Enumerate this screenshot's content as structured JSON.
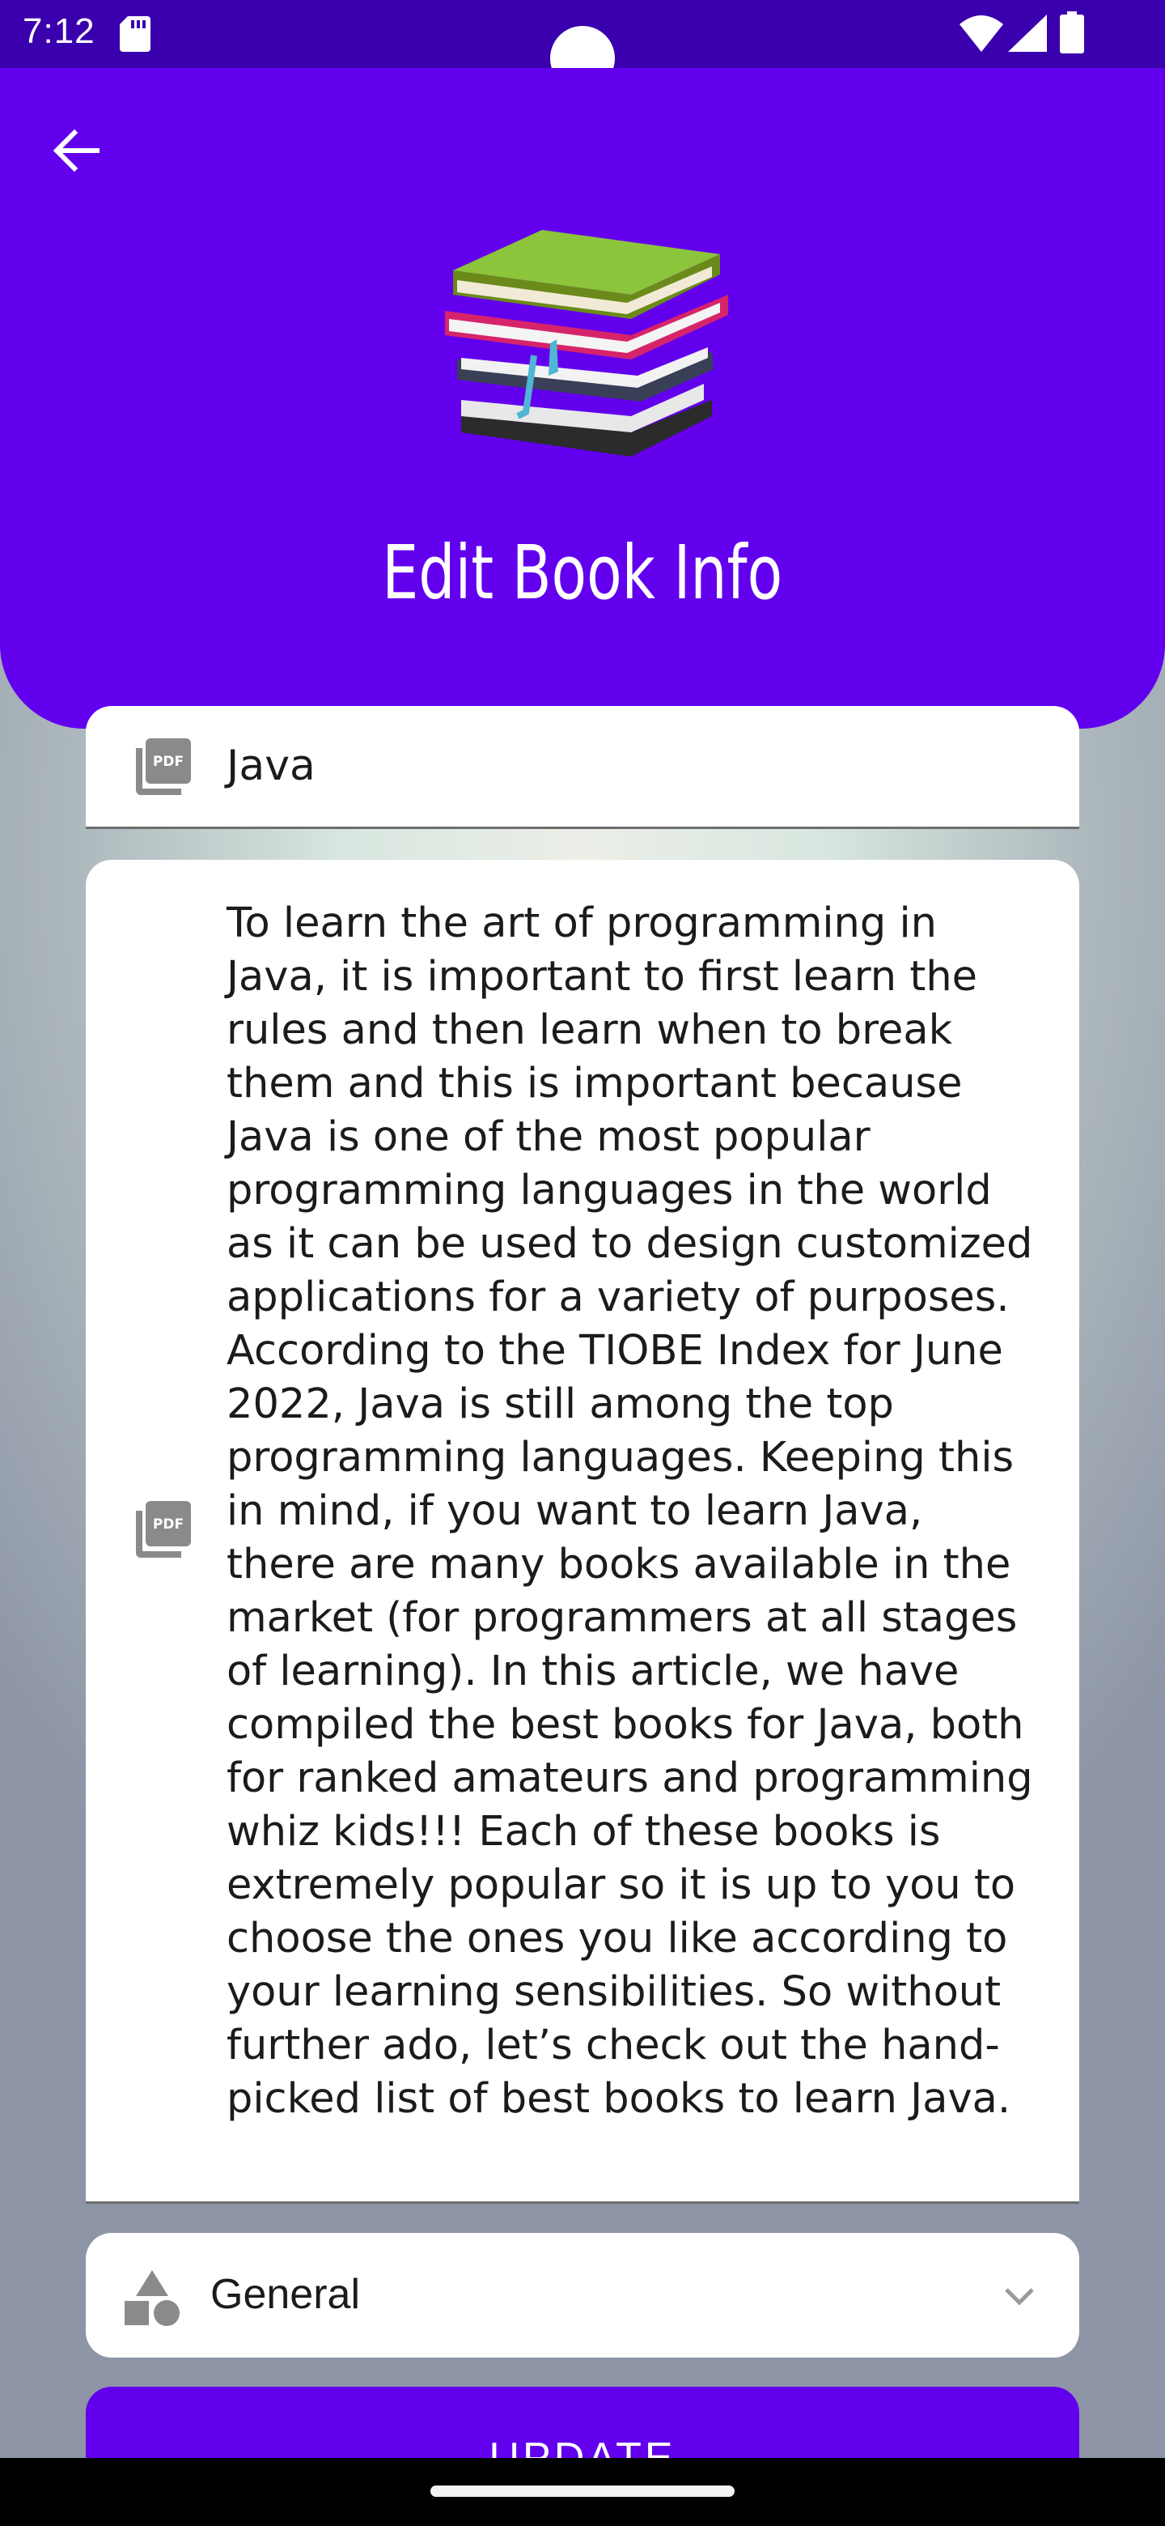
{
  "status_bar": {
    "time": "7:12",
    "icons": [
      "sd-card-icon",
      "wifi-icon",
      "cellular-icon",
      "battery-icon"
    ]
  },
  "header": {
    "title": "Edit Book Info",
    "back_icon": "arrow-left-icon",
    "illustration": "stack-of-books",
    "background_color": "#6200ee"
  },
  "form": {
    "title_field": {
      "icon": "pdf-icon",
      "value": "Java"
    },
    "description_field": {
      "icon": "pdf-icon",
      "value": "To learn the art of programming in Java, it is important to first learn the rules and then learn when to break them and this is important because Java is one of the most popular programming languages in the world as it can be used to design customized applications for a variety of purposes. According to the TIOBE Index for June 2022, Java is still among the top programming languages. Keeping this in mind, if you want to learn Java, there are many books available in the market (for programmers at all stages of learning). In this article, we have compiled the best books for Java, both for ranked amateurs and programming whiz kids!!! Each of these books is extremely popular so it is up to you to choose the ones you like according to your learning sensibilities. So without further ado, let’s check out the hand-picked list of best books to learn Java."
    },
    "category_field": {
      "icon": "shapes-icon",
      "selected": "General",
      "dropdown_icon": "chevron-down-icon"
    },
    "update_button": {
      "label": "UPDATE"
    }
  },
  "colors": {
    "accent": "#6200ee",
    "status_bar": "#3a00ad"
  }
}
